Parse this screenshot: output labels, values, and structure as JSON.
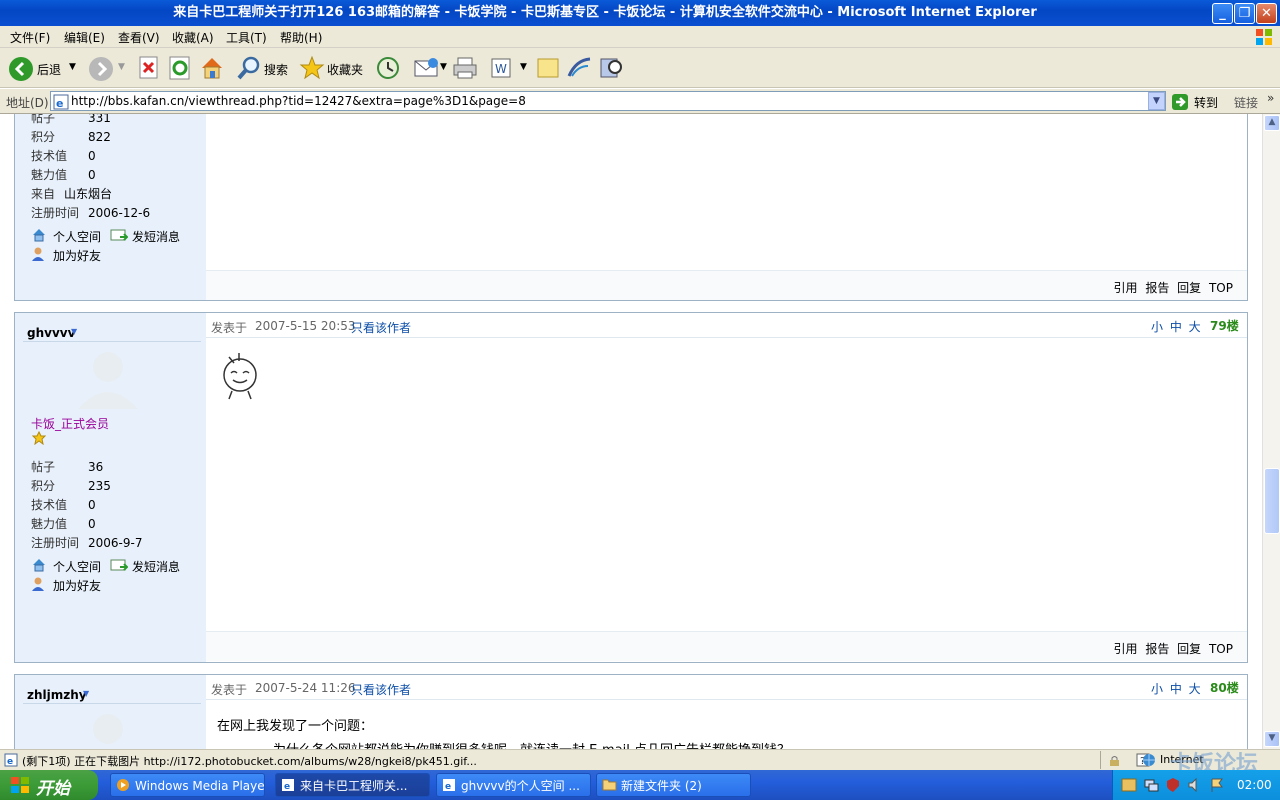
{
  "window": {
    "title": "来自卡巴工程师关于打开126 163邮箱的解答 - 卡饭学院 - 卡巴斯基专区 - 卡饭论坛 - 计算机安全软件交流中心 - Microsoft Internet Explorer",
    "minimize": "_",
    "maximize": "❐",
    "close": "✕"
  },
  "menubar": [
    "文件(F)",
    "编辑(E)",
    "查看(V)",
    "收藏(A)",
    "工具(T)",
    "帮助(H)"
  ],
  "toolbar": {
    "back_label": "后退",
    "search_label": "搜索",
    "favorites_label": "收藏夹"
  },
  "address": {
    "label": "地址(D)",
    "url": "http://bbs.kafan.cn/viewthread.php?tid=12427&extra=page%3D1&page=8",
    "go_label": "转到",
    "links_label": "链接"
  },
  "post_prev": {
    "stats": [
      {
        "k": "帖子",
        "v": "331"
      },
      {
        "k": "积分",
        "v": "822"
      },
      {
        "k": "技术值",
        "v": "0"
      },
      {
        "k": "魅力值",
        "v": "0"
      },
      {
        "k": "来自",
        "v": "山东烟台"
      },
      {
        "k": "注册时间",
        "v": "2006-12-6"
      }
    ],
    "space_label": "个人空间",
    "pm_label": "发短消息",
    "friend_label": "加为好友",
    "foot": "引用 报告 回复 TOP"
  },
  "post79": {
    "username": "ghvvvv",
    "posted_prefix": "发表于",
    "date": "2007-5-15 20:53",
    "only_author": "只看该作者",
    "sizes": "小 中 大",
    "floor": "79楼",
    "group": "卡饭_正式会员",
    "stats": [
      {
        "k": "帖子",
        "v": "36"
      },
      {
        "k": "积分",
        "v": "235"
      },
      {
        "k": "技术值",
        "v": "0"
      },
      {
        "k": "魅力值",
        "v": "0"
      },
      {
        "k": "注册时间",
        "v": "2006-9-7"
      }
    ],
    "space_label": "个人空间",
    "pm_label": "发短消息",
    "friend_label": "加为好友",
    "foot": "引用 报告 回复 TOP"
  },
  "post80": {
    "username": "zhljmzhy",
    "posted_prefix": "发表于",
    "date": "2007-5-24 11:26",
    "only_author": "只看该作者",
    "sizes": "小 中 大",
    "floor": "80楼",
    "line1": "在网上我发现了一个问题：",
    "line2": "为什么各个网站都说能为你赚到很多钱呢，就连读一封 E-mail 点几回广告栏都能挣到钱？"
  },
  "statusbar": {
    "text": "(剩下1项) 正在下载图片 http://i172.photobucket.com/albums/w28/ngkei8/pk451.gif...",
    "zone": "Internet",
    "watermark": "卡饭论坛"
  },
  "taskbar": {
    "start": "开始",
    "tasks": [
      "Windows Media Player",
      "来自卡巴工程师关...",
      "ghvvvv的个人空间 ...",
      "新建文件夹 (2)"
    ],
    "time": "02:00"
  },
  "colors": {
    "titlebar": "#0a4fd0",
    "sidebar": "#e8f1fb",
    "link_blue": "#0c4ea8",
    "floor_green": "#2a8a1a",
    "group_purple": "#990099"
  }
}
